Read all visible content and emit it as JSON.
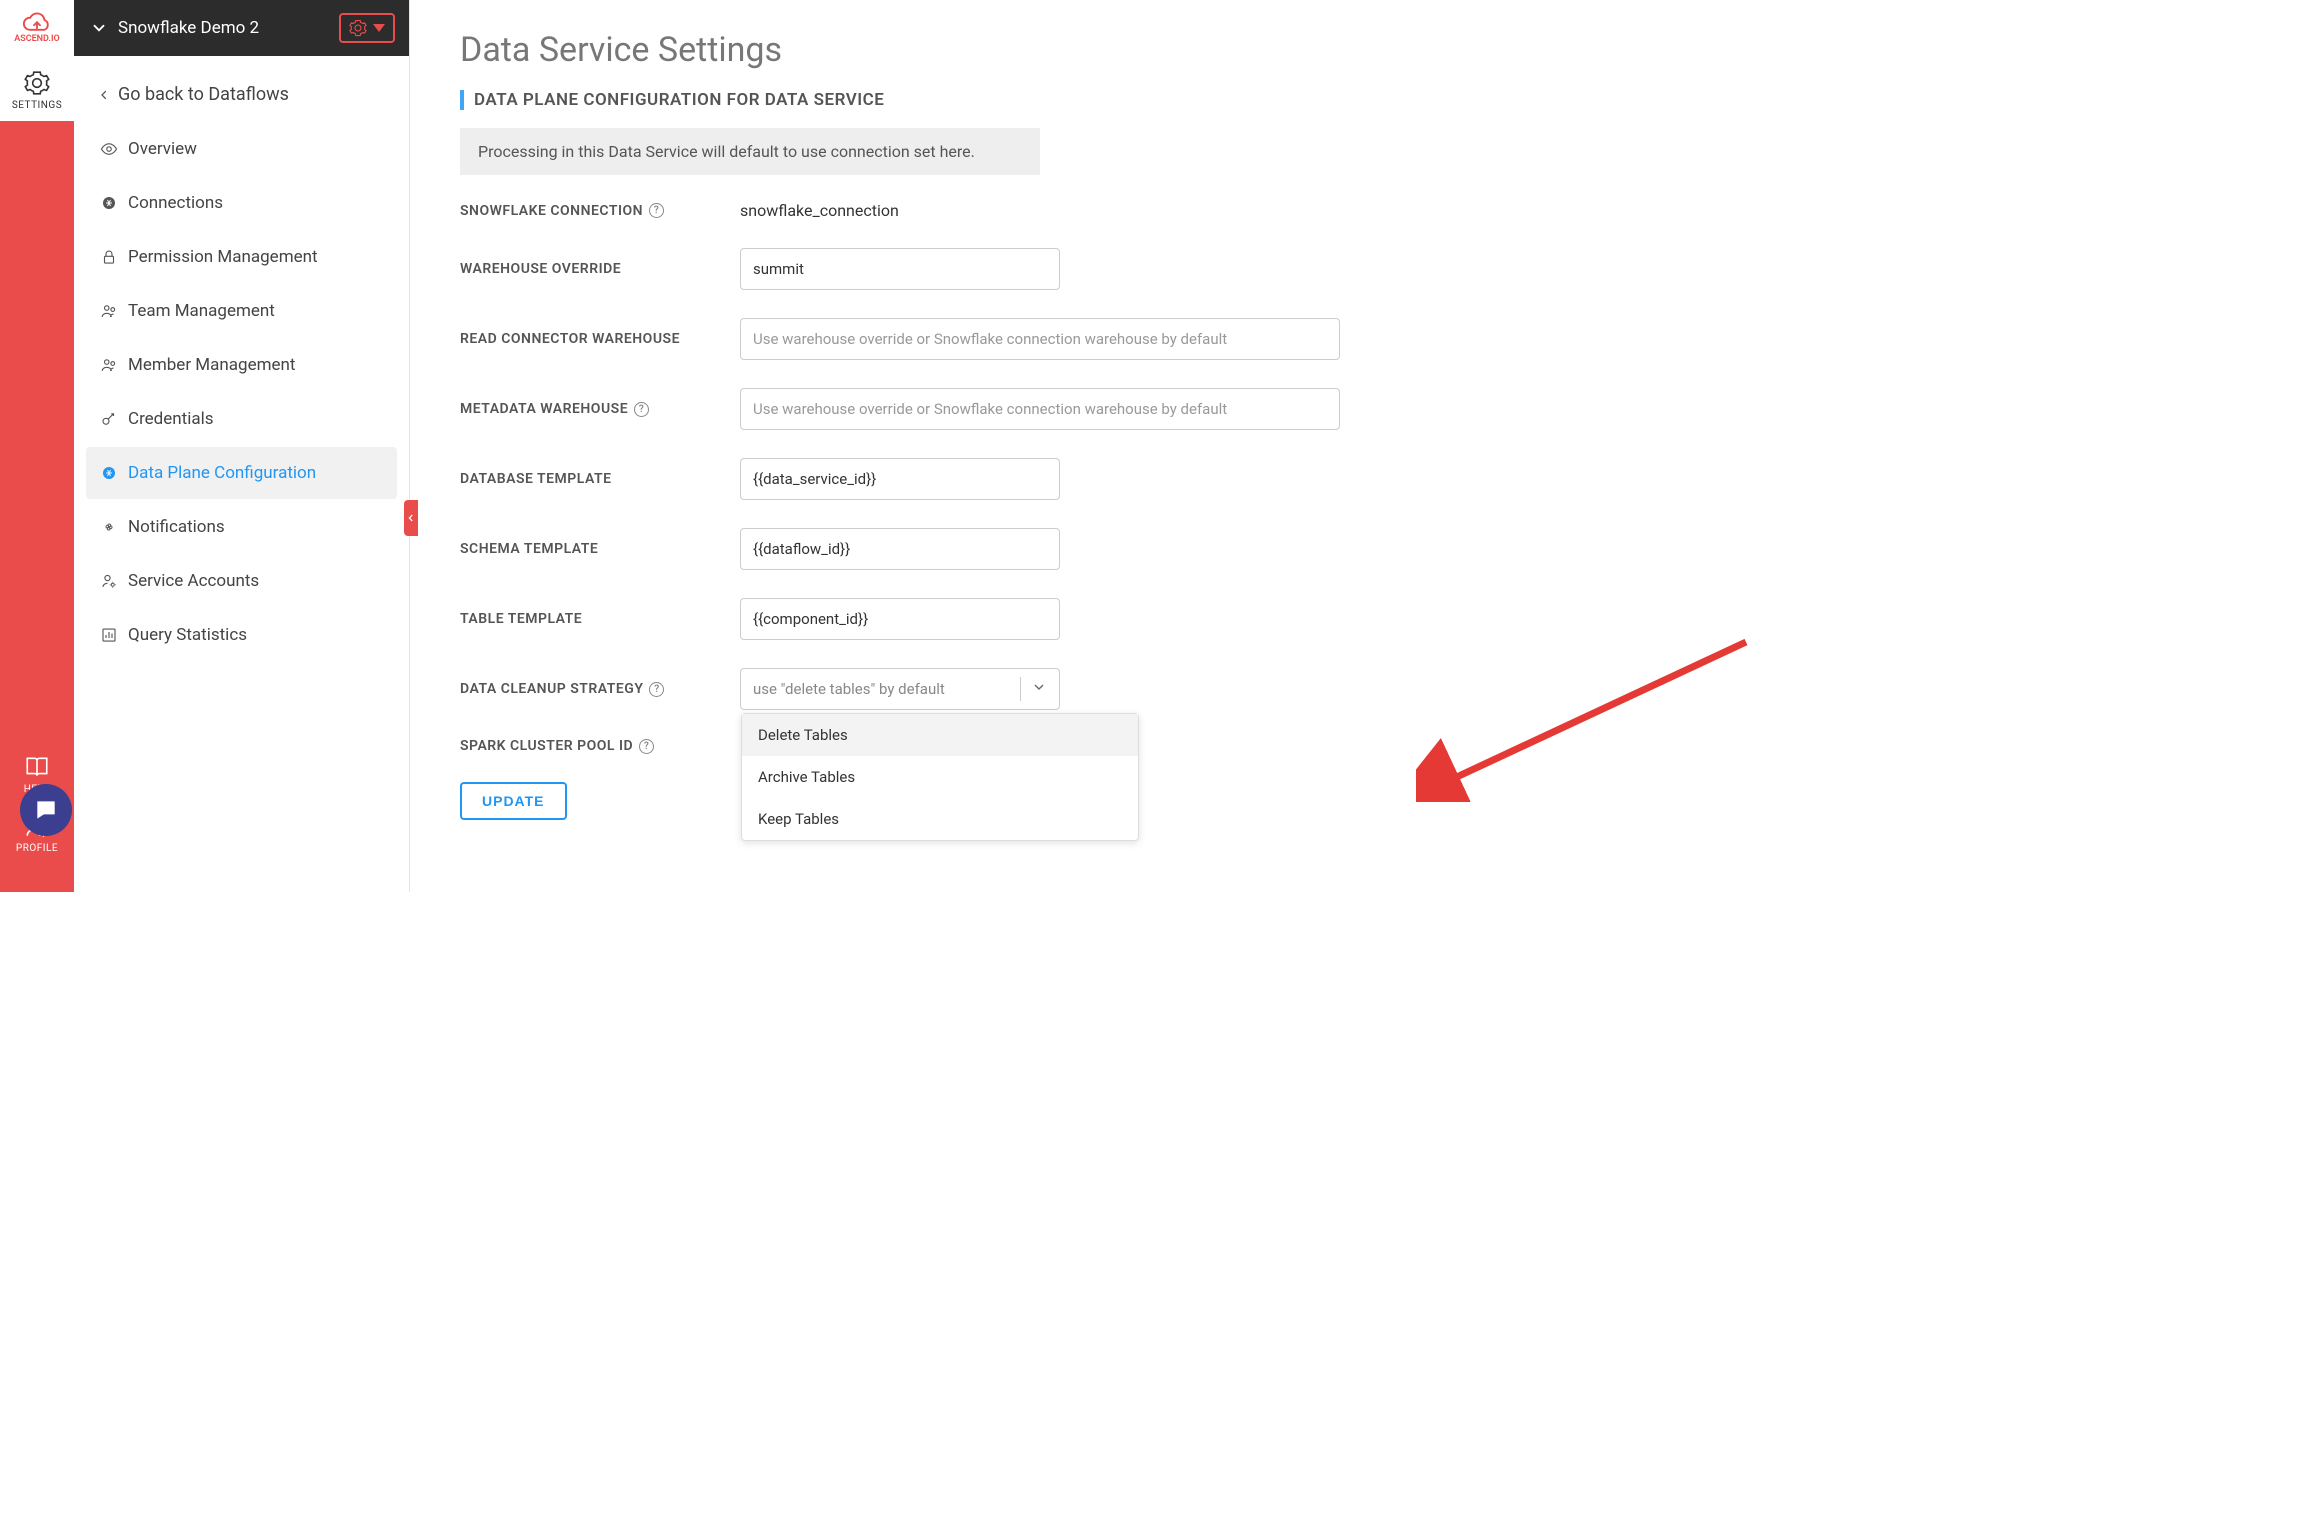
{
  "rail": {
    "brand": "ASCEND.IO",
    "items": {
      "settings": "SETTINGS",
      "help": "HELP",
      "profile": "PROFILE"
    }
  },
  "sidebar": {
    "title": "Snowflake Demo 2",
    "back": "Go back to Dataflows",
    "items": [
      {
        "label": "Overview"
      },
      {
        "label": "Connections"
      },
      {
        "label": "Permission Management"
      },
      {
        "label": "Team Management"
      },
      {
        "label": "Member Management"
      },
      {
        "label": "Credentials"
      },
      {
        "label": "Data Plane Configuration"
      },
      {
        "label": "Notifications"
      },
      {
        "label": "Service Accounts"
      },
      {
        "label": "Query Statistics"
      }
    ]
  },
  "main": {
    "title": "Data Service Settings",
    "section": "DATA PLANE CONFIGURATION FOR DATA SERVICE",
    "banner": "Processing in this Data Service will default to use connection set here.",
    "fields": {
      "connection_label": "SNOWFLAKE CONNECTION",
      "connection_value": "snowflake_connection",
      "warehouse_override_label": "WAREHOUSE OVERRIDE",
      "warehouse_override_value": "summit",
      "read_connector_label": "READ CONNECTOR WAREHOUSE",
      "read_connector_placeholder": "Use warehouse override or Snowflake connection warehouse by default",
      "metadata_label": "METADATA WAREHOUSE",
      "metadata_placeholder": "Use warehouse override or Snowflake connection warehouse by default",
      "database_template_label": "DATABASE TEMPLATE",
      "database_template_value": "{{data_service_id}}",
      "schema_template_label": "SCHEMA TEMPLATE",
      "schema_template_value": "{{dataflow_id}}",
      "table_template_label": "TABLE TEMPLATE",
      "table_template_value": "{{component_id}}",
      "cleanup_label": "DATA CLEANUP STRATEGY",
      "cleanup_placeholder": "use \"delete tables\" by default",
      "cleanup_options": [
        "Delete Tables",
        "Archive Tables",
        "Keep Tables"
      ],
      "spark_label": "SPARK CLUSTER POOL ID"
    },
    "update_button": "UPDATE"
  }
}
